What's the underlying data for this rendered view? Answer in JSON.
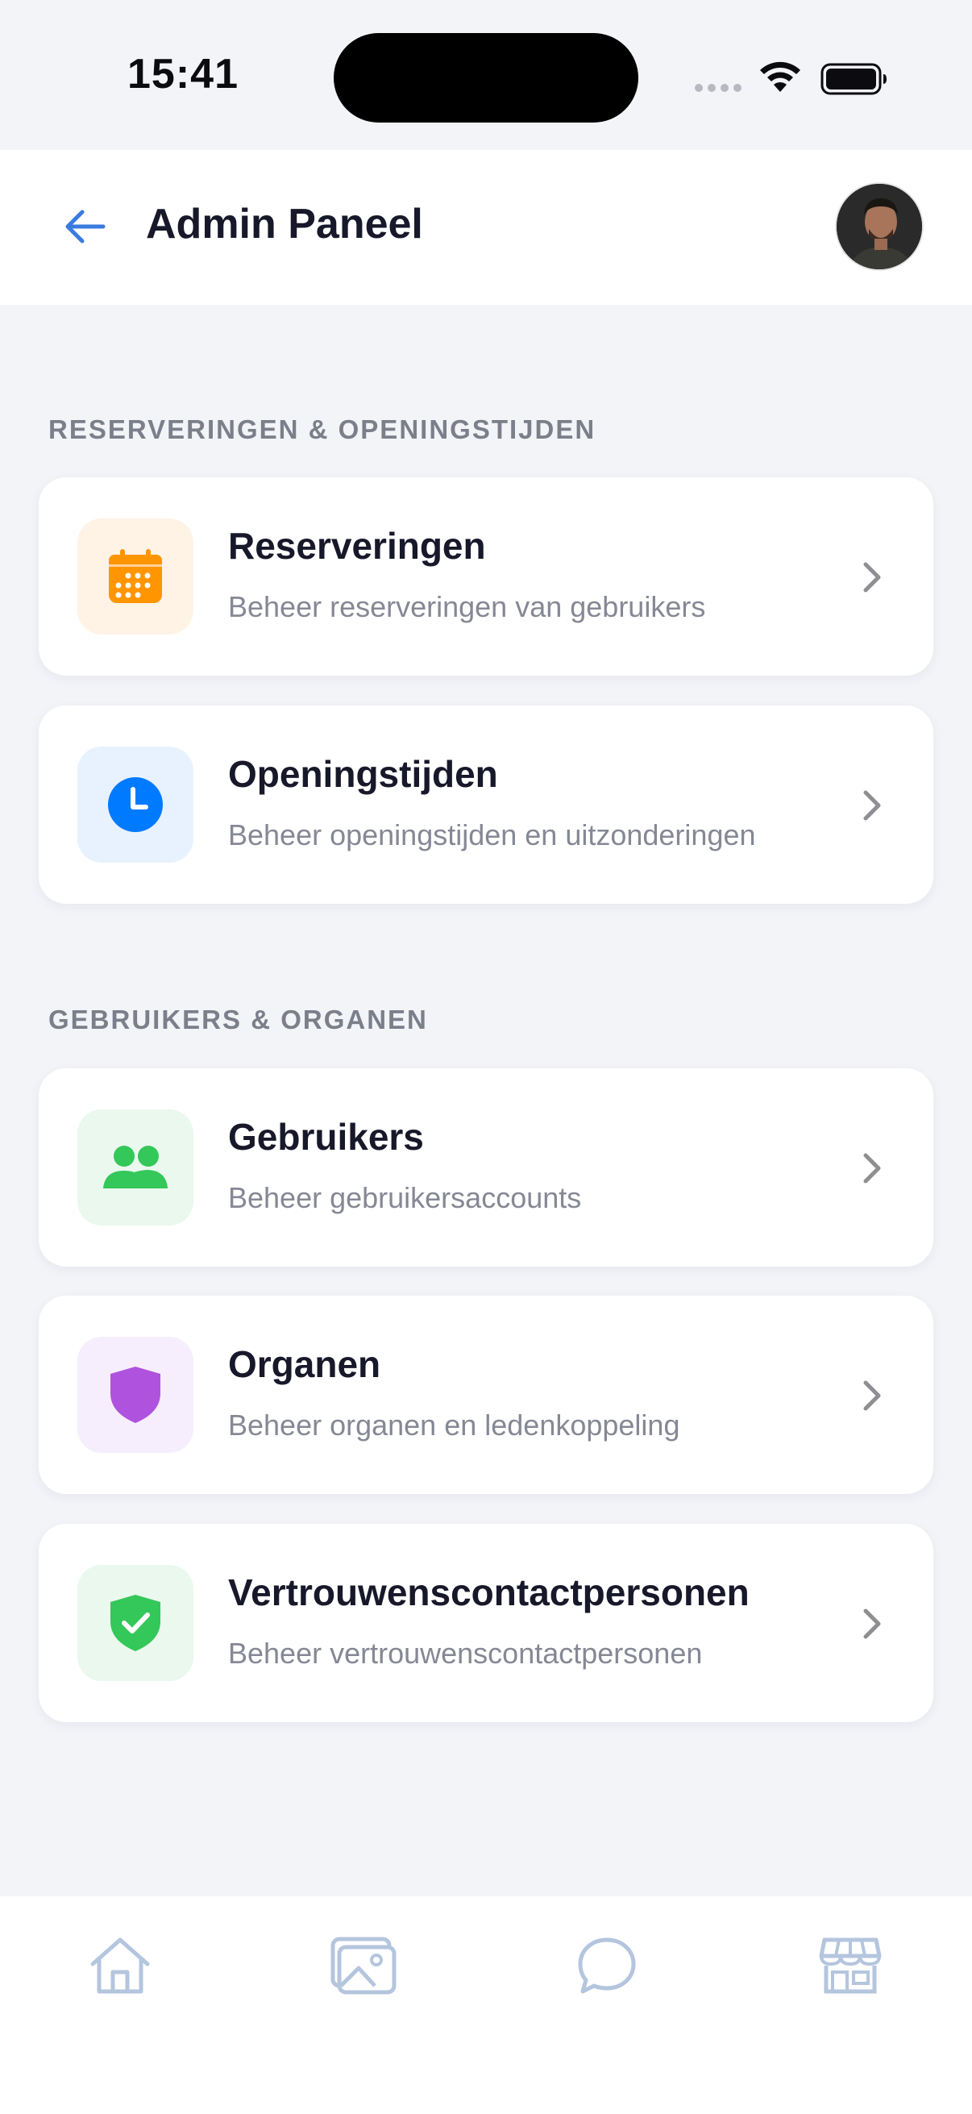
{
  "status_bar": {
    "time": "15:41"
  },
  "header": {
    "title": "Admin Paneel",
    "back_icon": "arrow-left-icon",
    "avatar": "user-avatar"
  },
  "sections": [
    {
      "title": "RESERVERINGEN & OPENINGSTIJDEN",
      "items": [
        {
          "title": "Reserveringen",
          "subtitle": "Beheer reserveringen van gebruikers",
          "icon": "calendar-icon",
          "icon_color": "#FF9500",
          "icon_bg": "#FFF3E6"
        },
        {
          "title": "Openingstijden",
          "subtitle": "Beheer openingstijden en uitzonderingen",
          "icon": "clock-icon",
          "icon_color": "#007AFF",
          "icon_bg": "#E8F2FE"
        }
      ]
    },
    {
      "title": "GEBRUIKERS & ORGANEN",
      "items": [
        {
          "title": "Gebruikers",
          "subtitle": "Beheer gebruikersaccounts",
          "icon": "users-icon",
          "icon_color": "#34C759",
          "icon_bg": "#EAF8EE"
        },
        {
          "title": "Organen",
          "subtitle": "Beheer organen en ledenkoppeling",
          "icon": "shield-icon",
          "icon_color": "#AF52DE",
          "icon_bg": "#F6EEFC"
        },
        {
          "title": "Vertrouwenscontactpersonen",
          "subtitle": "Beheer vertrouwenscontactpersonen",
          "icon": "shield-check-icon",
          "icon_color": "#34C759",
          "icon_bg": "#EAF8EE"
        }
      ]
    }
  ],
  "bottom_nav": [
    {
      "icon": "home-icon"
    },
    {
      "icon": "gallery-icon"
    },
    {
      "icon": "chat-icon"
    },
    {
      "icon": "store-icon"
    }
  ],
  "colors": {
    "accent": "#3A7BE0",
    "nav_icon": "#B4C5DE",
    "background": "#F3F4F8"
  }
}
